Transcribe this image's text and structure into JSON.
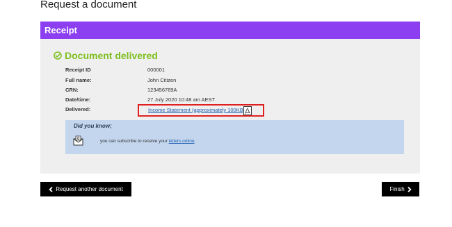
{
  "page": {
    "title": "Request a document"
  },
  "receipt": {
    "header": "Receipt",
    "status": "Document delivered",
    "details": [
      {
        "label": "Receipt ID",
        "value": "000001"
      },
      {
        "label": "Full name:",
        "value": "John Citizen"
      },
      {
        "label": "CRN:",
        "value": "123456789A"
      },
      {
        "label": "Date/time:",
        "value": "27 July 2020 10:48 am AEST"
      },
      {
        "label": "Delivered:"
      }
    ],
    "delivered_link": "Income Statement (approximately 100KB)",
    "info": {
      "heading": "Did you know;",
      "text": "you can subscribe to receive your",
      "link": "letters online",
      "suffix": "."
    }
  },
  "buttons": {
    "back": "Request another document",
    "finish": "Finish"
  },
  "colors": {
    "header": "#8c3ff0",
    "status": "#7fbf1f",
    "highlight_border": "#e02020",
    "info_bg": "#c3d6ee",
    "link": "#1f5fb3"
  },
  "icons": [
    "check-circle-icon",
    "pdf-icon",
    "mail-icon",
    "chevron-left-icon",
    "chevron-right-icon"
  ]
}
